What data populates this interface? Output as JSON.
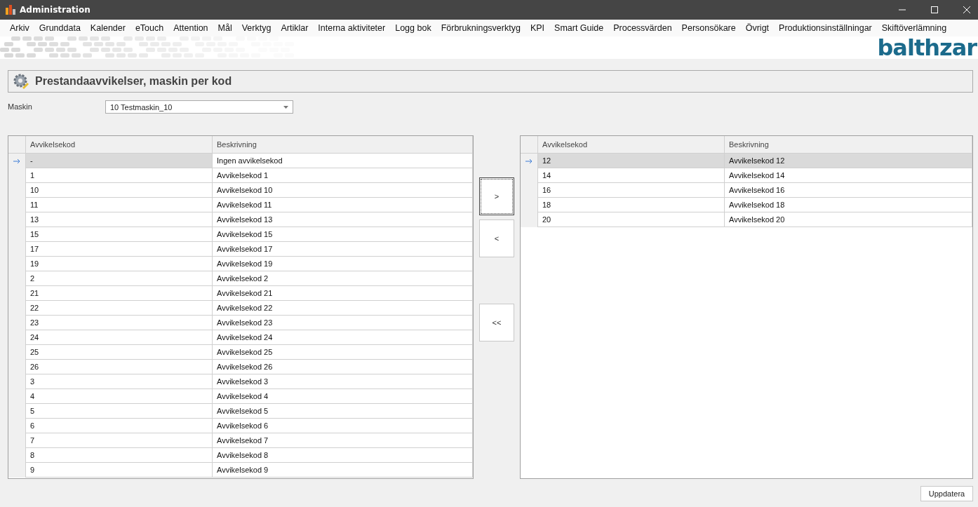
{
  "window": {
    "title": "Administration"
  },
  "menu": [
    "Arkiv",
    "Grunddata",
    "Kalender",
    "eTouch",
    "Attention",
    "Mål",
    "Verktyg",
    "Artiklar",
    "Interna aktiviteter",
    "Logg bok",
    "Förbrukningsverktyg",
    "KPI",
    "Smart Guide",
    "Processvärden",
    "Personsökare",
    "Övrigt",
    "Produktionsinställningar",
    "Skiftöverlämning"
  ],
  "logo": "balthzar",
  "page_title": "Prestandaavvikelser, maskin per kod",
  "machine": {
    "label": "Maskin",
    "value": "10 Testmaskin_10"
  },
  "available": {
    "columns": [
      "Avvikelsekod",
      "Beskrivning"
    ],
    "rows": [
      {
        "code": "-",
        "description": "Ingen avvikelsekod",
        "selected": true
      },
      {
        "code": "1",
        "description": "Avvikelsekod 1",
        "selected": false
      },
      {
        "code": "10",
        "description": "Avvikelsekod 10",
        "selected": false
      },
      {
        "code": "11",
        "description": "Avvikelsekod 11",
        "selected": false
      },
      {
        "code": "13",
        "description": "Avvikelsekod 13",
        "selected": false
      },
      {
        "code": "15",
        "description": "Avvikelsekod 15",
        "selected": false
      },
      {
        "code": "17",
        "description": "Avvikelsekod 17",
        "selected": false
      },
      {
        "code": "19",
        "description": "Avvikelsekod 19",
        "selected": false
      },
      {
        "code": "2",
        "description": "Avvikelsekod 2",
        "selected": false
      },
      {
        "code": "21",
        "description": "Avvikelsekod 21",
        "selected": false
      },
      {
        "code": "22",
        "description": "Avvikelsekod 22",
        "selected": false
      },
      {
        "code": "23",
        "description": "Avvikelsekod 23",
        "selected": false
      },
      {
        "code": "24",
        "description": "Avvikelsekod 24",
        "selected": false
      },
      {
        "code": "25",
        "description": "Avvikelsekod 25",
        "selected": false
      },
      {
        "code": "26",
        "description": "Avvikelsekod 26",
        "selected": false
      },
      {
        "code": "3",
        "description": "Avvikelsekod 3",
        "selected": false
      },
      {
        "code": "4",
        "description": "Avvikelsekod 4",
        "selected": false
      },
      {
        "code": "5",
        "description": "Avvikelsekod 5",
        "selected": false
      },
      {
        "code": "6",
        "description": "Avvikelsekod 6",
        "selected": false
      },
      {
        "code": "7",
        "description": "Avvikelsekod 7",
        "selected": false
      },
      {
        "code": "8",
        "description": "Avvikelsekod 8",
        "selected": false
      },
      {
        "code": "9",
        "description": "Avvikelsekod 9",
        "selected": false
      }
    ]
  },
  "transfer_buttons": [
    {
      "label": ">",
      "focused": true
    },
    {
      "label": "<",
      "focused": false
    },
    {
      "label": "<<",
      "focused": false
    }
  ],
  "assigned": {
    "columns": [
      "Avvikelsekod",
      "Beskrivning"
    ],
    "rows": [
      {
        "code": "12",
        "description": "Avvikelsekod 12",
        "selected": true
      },
      {
        "code": "14",
        "description": "Avvikelsekod 14",
        "selected": false
      },
      {
        "code": "16",
        "description": "Avvikelsekod 16",
        "selected": false
      },
      {
        "code": "18",
        "description": "Avvikelsekod 18",
        "selected": false
      },
      {
        "code": "20",
        "description": "Avvikelsekod 20",
        "selected": false
      }
    ]
  },
  "update_button": "Uppdatera"
}
